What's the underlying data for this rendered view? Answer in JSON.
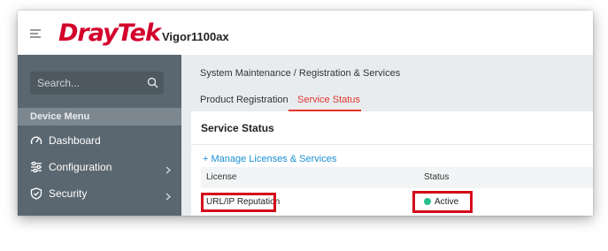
{
  "header": {
    "logo_text": "DrayTek",
    "model": "Vigor1100ax"
  },
  "sidebar": {
    "search_placeholder": "Search...",
    "menu_header": "Device Menu",
    "items": [
      {
        "label": "Dashboard",
        "icon": "gauge-icon",
        "has_children": false
      },
      {
        "label": "Configuration",
        "icon": "sliders-icon",
        "has_children": true
      },
      {
        "label": "Security",
        "icon": "shield-icon",
        "has_children": true
      }
    ]
  },
  "main": {
    "breadcrumb": "System Maintenance / Registration & Services",
    "tabs": [
      {
        "label": "Product Registration",
        "active": false
      },
      {
        "label": "Service Status",
        "active": true
      }
    ],
    "card_title": "Service Status",
    "manage_link": "+ Manage Licenses & Services",
    "table": {
      "columns": [
        "License",
        "Status"
      ],
      "rows": [
        {
          "license": "URL/IP Reputation",
          "status": "Active"
        }
      ]
    }
  },
  "colors": {
    "brand_red": "#d3002b",
    "accent_tab": "#e2352d",
    "link_blue": "#1a8fd4",
    "status_active": "#2bbf8f",
    "highlight_box": "#d40a1a",
    "sidebar_bg": "#5b6770"
  }
}
